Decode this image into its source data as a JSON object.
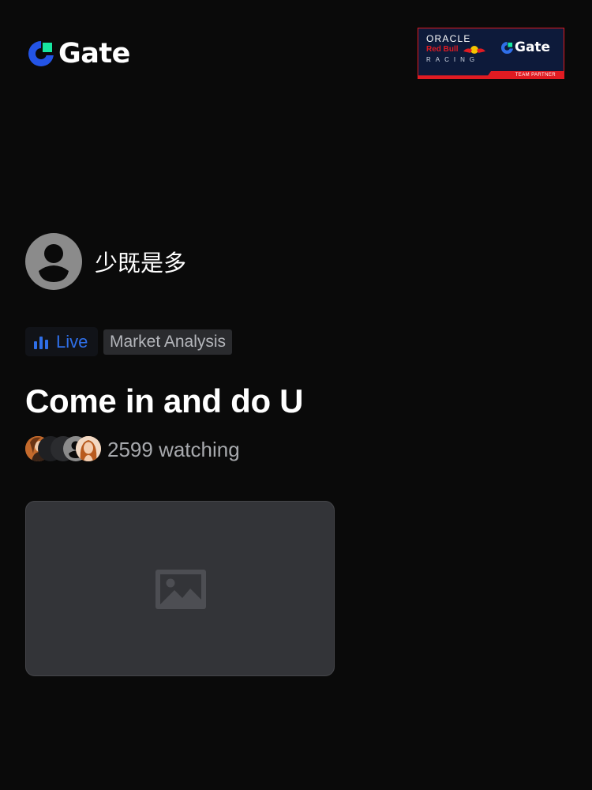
{
  "header": {
    "brand": "Gate",
    "partner": {
      "oracle": "ORACLE",
      "redbull": "Red Bull",
      "racing": "RACING",
      "gate": "Gate",
      "team_label": "TEAM PARTNER"
    }
  },
  "host": {
    "name": "少既是多"
  },
  "tags": {
    "live": "Live",
    "category": "Market Analysis"
  },
  "stream": {
    "title": "Come in and do U",
    "viewers": "2599 watching"
  },
  "icons": {
    "brand": "gate-logo-icon",
    "live": "bar-chart-icon",
    "preview": "image-placeholder-icon",
    "host": "default-avatar-icon"
  },
  "colors": {
    "background": "#0a0a0a",
    "accent_blue": "#2f6fe8",
    "brand_green": "#17e6a1",
    "partner_red": "#e01b22",
    "muted_text": "#a7a9ad"
  }
}
